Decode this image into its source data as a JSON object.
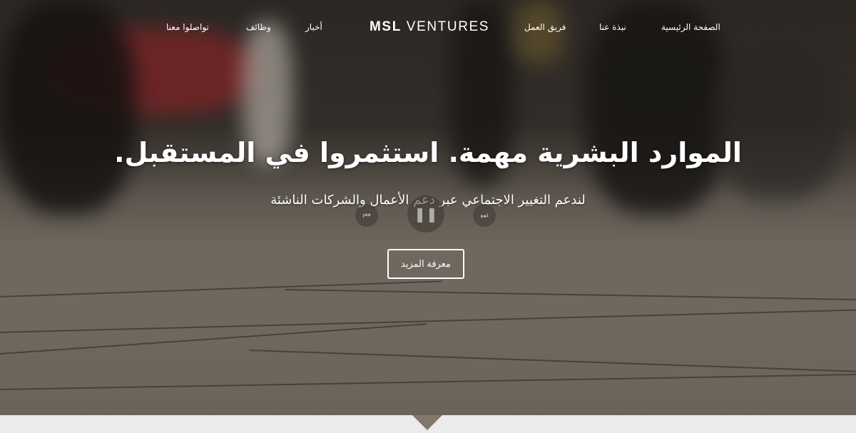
{
  "brand": {
    "bold": "MSL",
    "light": "VENTURES"
  },
  "nav": {
    "contact": "تواصلوا معنا",
    "jobs": "وظائف",
    "news": "أخبار",
    "team": "فريق العمل",
    "about": "نبذة عنا",
    "home": "الصفحة الرئيسية"
  },
  "hero": {
    "headline": "الموارد البشرية مهمة. استثمروا في المستقبل.",
    "subheadline": "لندعم التغيير الاجتماعي عبر دعم الأعمال والشركات الناشئة",
    "cta_label": "معرفة المزيد"
  },
  "video_controls": {
    "prev_icon": "⏮",
    "pause_icon": "❚❚",
    "next_icon": "⏭"
  }
}
